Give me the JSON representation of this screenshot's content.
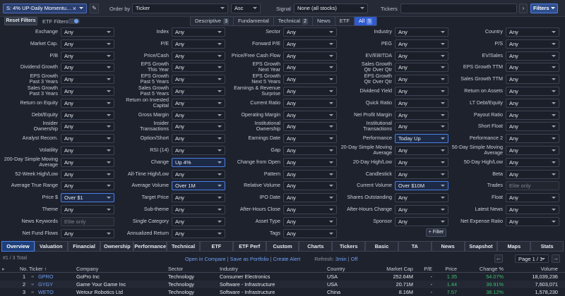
{
  "toolbar": {
    "screen_name": "S: 4% UP-Daily Momentu…",
    "order_by_label": "Order by",
    "order_by_value": "Ticker",
    "order_dir": "Asc",
    "signal_label": "Signal",
    "signal_value": "None (all stocks)",
    "tickers_label": "Tickers",
    "tickers_value": "",
    "filters_button": "Filters"
  },
  "subbar": {
    "reset_label": "Reset Filters",
    "etf_filters_label": "ETF Filters",
    "etf_filters_on": true,
    "tabs": [
      {
        "label": "Descriptive",
        "count": "3"
      },
      {
        "label": "Fundamental",
        "count": ""
      },
      {
        "label": "Technical",
        "count": "2"
      },
      {
        "label": "News",
        "count": ""
      },
      {
        "label": "ETF",
        "count": ""
      },
      {
        "label": "All",
        "count": "5"
      }
    ],
    "active_tab": "All"
  },
  "filters": [
    [
      {
        "label": "Exchange",
        "value": "Any"
      },
      {
        "label": "Index",
        "value": "Any"
      },
      {
        "label": "Sector",
        "value": "Any"
      },
      {
        "label": "Industry",
        "value": "Any"
      },
      {
        "label": "Country",
        "value": "Any"
      }
    ],
    [
      {
        "label": "Market Cap.",
        "value": "Any"
      },
      {
        "label": "P/E",
        "value": "Any"
      },
      {
        "label": "Forward P/E",
        "value": "Any"
      },
      {
        "label": "PEG",
        "value": "Any"
      },
      {
        "label": "P/S",
        "value": "Any"
      }
    ],
    [
      {
        "label": "P/B",
        "value": "Any"
      },
      {
        "label": "Price/Cash",
        "value": "Any"
      },
      {
        "label": "Price/Free Cash Flow",
        "value": "Any"
      },
      {
        "label": "EV/EBITDA",
        "value": "Any"
      },
      {
        "label": "EV/Sales",
        "value": "Any"
      }
    ],
    [
      {
        "label": "Dividend Growth",
        "value": "Any"
      },
      {
        "label": "EPS Growth\nThis Year",
        "value": "Any"
      },
      {
        "label": "EPS Growth\nNext Year",
        "value": "Any"
      },
      {
        "label": "Sales Growth\nQtr Over Qtr",
        "value": "Any"
      },
      {
        "label": "EPS Growth TTM",
        "value": "Any"
      }
    ],
    [
      {
        "label": "EPS Growth\nPast 3 Years",
        "value": "Any"
      },
      {
        "label": "EPS Growth\nPast 5 Years",
        "value": "Any"
      },
      {
        "label": "EPS Growth\nNext 5 Years",
        "value": "Any"
      },
      {
        "label": "EPS Growth\nQtr Over Qtr",
        "value": "Any"
      },
      {
        "label": "Sales Growth TTM",
        "value": "Any"
      }
    ],
    [
      {
        "label": "Sales Growth\nPast 3 Years",
        "value": "Any"
      },
      {
        "label": "Sales Growth\nPast 5 Years",
        "value": "Any"
      },
      {
        "label": "Earnings & Revenue\nSurprise",
        "value": "Any"
      },
      {
        "label": "Dividend Yield",
        "value": "Any"
      },
      {
        "label": "Return on Assets",
        "value": "Any"
      }
    ],
    [
      {
        "label": "Return on Equity",
        "value": "Any"
      },
      {
        "label": "Return on Invested\nCapital",
        "value": "Any"
      },
      {
        "label": "Current Ratio",
        "value": "Any"
      },
      {
        "label": "Quick Ratio",
        "value": "Any"
      },
      {
        "label": "LT Debt/Equity",
        "value": "Any"
      }
    ],
    [
      {
        "label": "Debt/Equity",
        "value": "Any"
      },
      {
        "label": "Gross Margin",
        "value": "Any"
      },
      {
        "label": "Operating Margin",
        "value": "Any"
      },
      {
        "label": "Net Profit Margin",
        "value": "Any"
      },
      {
        "label": "Payout Ratio",
        "value": "Any"
      }
    ],
    [
      {
        "label": "Insider\nOwnership",
        "value": "Any"
      },
      {
        "label": "Insider\nTransactions",
        "value": "Any"
      },
      {
        "label": "Institutional\nOwnership",
        "value": "Any"
      },
      {
        "label": "Institutional\nTransactions",
        "value": "Any"
      },
      {
        "label": "Short Float",
        "value": "Any"
      }
    ],
    [
      {
        "label": "Analyst Recom.",
        "value": "Any"
      },
      {
        "label": "Option/Short",
        "value": "Any"
      },
      {
        "label": "Earnings Date",
        "value": "Any"
      },
      {
        "label": "Performance",
        "value": "Today Up",
        "active": true
      },
      {
        "label": "Performance 2",
        "value": "Any"
      }
    ],
    [
      {
        "label": "Volatility",
        "value": "Any"
      },
      {
        "label": "RSI (14)",
        "value": "Any"
      },
      {
        "label": "Gap",
        "value": "Any"
      },
      {
        "label": "20-Day Simple Moving\nAverage",
        "value": "Any"
      },
      {
        "label": "50-Day Simple Moving\nAverage",
        "value": "Any"
      }
    ],
    [
      {
        "label": "200-Day Simple Moving\nAverage",
        "value": "Any"
      },
      {
        "label": "Change",
        "value": "Up 4%",
        "active": true
      },
      {
        "label": "Change from Open",
        "value": "Any"
      },
      {
        "label": "20-Day High/Low",
        "value": "Any"
      },
      {
        "label": "50-Day High/Low",
        "value": "Any"
      }
    ],
    [
      {
        "label": "52-Week High/Low",
        "value": "Any"
      },
      {
        "label": "All-Time High/Low",
        "value": "Any"
      },
      {
        "label": "Pattern",
        "value": "Any"
      },
      {
        "label": "Candlestick",
        "value": "Any"
      },
      {
        "label": "Beta",
        "value": "Any"
      }
    ],
    [
      {
        "label": "Average True Range",
        "value": "Any"
      },
      {
        "label": "Average Volume",
        "value": "Over 1M",
        "active": true
      },
      {
        "label": "Relative Volume",
        "value": "Any"
      },
      {
        "label": "Current Volume",
        "value": "Over $10M",
        "active": true
      },
      {
        "label": "Trades",
        "value": "Elite only",
        "disabled": true
      }
    ],
    [
      {
        "label": "Price $",
        "value": "Over $1",
        "active": true
      },
      {
        "label": "Target Price",
        "value": "Any"
      },
      {
        "label": "IPO Date",
        "value": "Any"
      },
      {
        "label": "Shares Outstanding",
        "value": "Any"
      },
      {
        "label": "Float",
        "value": "Any"
      }
    ],
    [
      {
        "label": "Theme",
        "value": "Any"
      },
      {
        "label": "Sub-theme",
        "value": "Any"
      },
      {
        "label": "After-Hours Close",
        "value": "Any"
      },
      {
        "label": "After-Hours Change",
        "value": "Any"
      },
      {
        "label": "Latest News",
        "value": "Any"
      }
    ],
    [
      {
        "label": "News Keywords",
        "value": "Elite only",
        "disabled": true
      },
      {
        "label": "Single Category",
        "value": "Any"
      },
      {
        "label": "Asset Type",
        "value": "Any"
      },
      {
        "label": "Sponsor",
        "value": "Any"
      },
      {
        "label": "Net Expense Ratio",
        "value": "Any"
      }
    ],
    [
      {
        "label": "Net Fund Flows",
        "value": "Any"
      },
      {
        "label": "Annualized Return",
        "value": "Any"
      },
      {
        "label": "Tags",
        "value": "Any"
      },
      null,
      null
    ]
  ],
  "add_filter_label": "+ Filter",
  "view_tabs": [
    "Overview",
    "Valuation",
    "Financial",
    "Ownership",
    "Performance",
    "Technical",
    "ETF",
    "ETF Perf",
    "Custom",
    "Charts",
    "Tickers",
    "Basic",
    "TA",
    "News",
    "Snapshot",
    "Maps",
    "Stats"
  ],
  "active_view": "Overview",
  "status": {
    "count": "#1 / 3 Total",
    "open_compare": "Open in Compare",
    "save_portfolio": "Save as Portfolio",
    "create_alert": "Create Alert",
    "refresh_label": "Refresh:",
    "refresh_value": "3min",
    "refresh_off": "Off",
    "page": "Page 1 / 1"
  },
  "table": {
    "headers": [
      "No.",
      "Ticker ↑",
      "Company",
      "Sector",
      "Industry",
      "Country",
      "Market Cap",
      "P/E",
      "Price",
      "Change %",
      "Volume"
    ],
    "rows": [
      [
        "1",
        "GPRO",
        "GoPro Inc",
        "Technology",
        "Consumer Electronics",
        "USA",
        "252.64M",
        "-",
        "1.35",
        "54.07%",
        "18,039,236"
      ],
      [
        "2",
        "GYGY",
        "Game Your Game Inc",
        "Technology",
        "Software - Infrastructure",
        "USA",
        "20.71M",
        "-",
        "1.44",
        "39.91%",
        "7,603,071"
      ],
      [
        "3",
        "WETO",
        "Wetour Robotics Ltd",
        "Technology",
        "Software - Infrastructure",
        "China",
        "8.16M",
        "-",
        "7.57",
        "38.12%",
        "1,578,230"
      ]
    ]
  }
}
